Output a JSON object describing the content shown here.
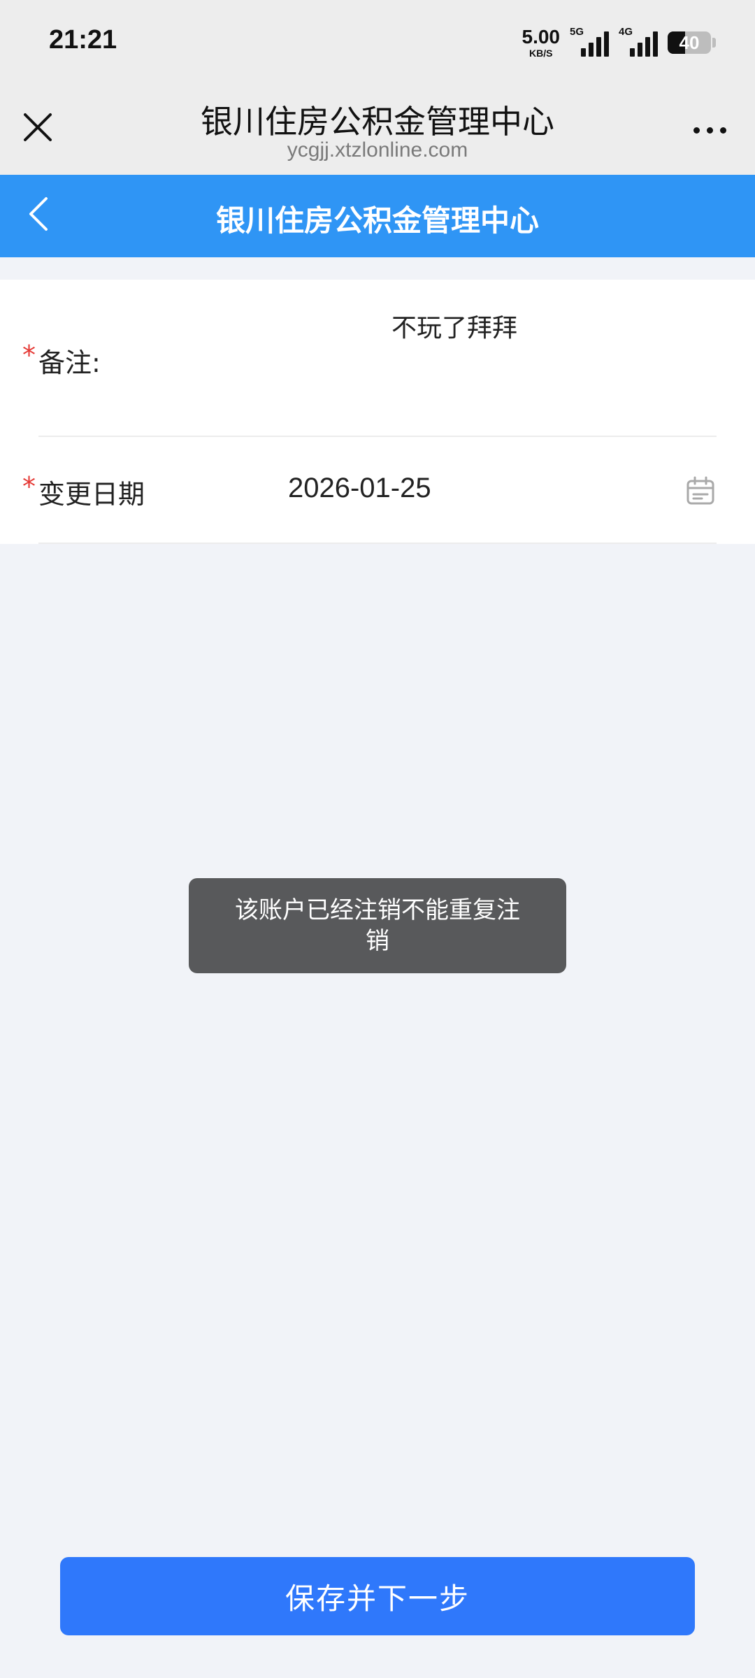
{
  "status_bar": {
    "time": "21:21",
    "net_speed_value": "5.00",
    "net_speed_unit": "KB/S",
    "signal1_label": "5G",
    "signal2_label": "4G",
    "battery_level": "40"
  },
  "browser": {
    "title": "银川住房公积金管理中心",
    "url": "ycgjj.xtzlonline.com"
  },
  "header": {
    "title": "银川住房公积金管理中心"
  },
  "form": {
    "remark": {
      "required_mark": "*",
      "label": "备注:",
      "value": "不玩了拜拜"
    },
    "change_date": {
      "required_mark": "*",
      "label": "变更日期",
      "value": "2026-01-25"
    }
  },
  "toast": {
    "message": "该账户已经注销不能重复注销"
  },
  "footer": {
    "save_label": "保存并下一步"
  },
  "colors": {
    "header_blue": "#2f95f5",
    "button_blue": "#2f78fb",
    "required_red": "#e53935",
    "toast_bg": "#58595b"
  },
  "icons": {
    "close": "close-icon",
    "more": "more-icon",
    "back": "chevron-left-icon",
    "calendar": "calendar-icon"
  }
}
